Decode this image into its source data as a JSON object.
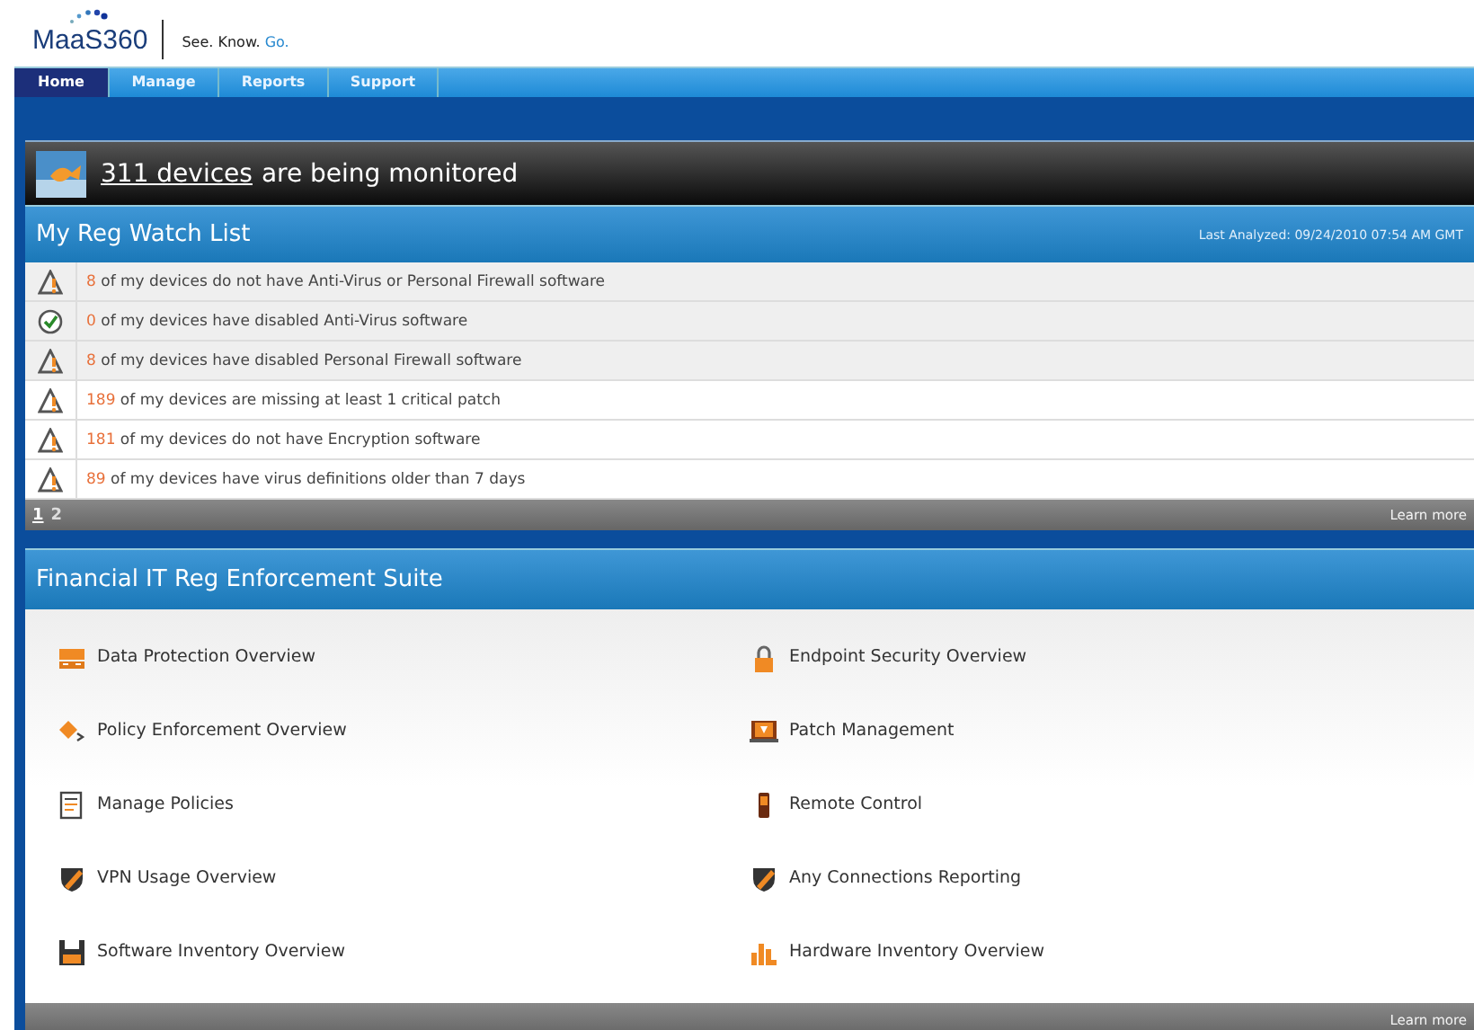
{
  "header": {
    "logo": "MaaS360",
    "tagline_plain": "See. Know.",
    "tagline_accent": "Go."
  },
  "nav": [
    {
      "label": "Home",
      "selected": true
    },
    {
      "label": "Manage",
      "selected": false
    },
    {
      "label": "Reports",
      "selected": false
    },
    {
      "label": "Support",
      "selected": false
    }
  ],
  "banner": {
    "link": "311 devices",
    "text": "are being monitored"
  },
  "watch_list": {
    "title": "My Reg Watch List",
    "last_analyzed": "Last Analyzed: 09/24/2010 07:54 AM GMT",
    "rows": [
      {
        "kind": "warning",
        "count": "8",
        "text": "of my devices do not have Anti-Virus or Personal Firewall software"
      },
      {
        "kind": "ok",
        "count": "0",
        "text": "of my devices have disabled Anti-Virus software"
      },
      {
        "kind": "warning",
        "count": "8",
        "text": "of my devices have disabled Personal Firewall software"
      },
      {
        "kind": "warning",
        "count": "189",
        "text": "of my devices are missing at least 1 critical patch"
      },
      {
        "kind": "warning",
        "count": "181",
        "text": "of my devices do not have Encryption software"
      },
      {
        "kind": "warning",
        "count": "89",
        "text": "of my devices have virus definitions older than 7 days"
      }
    ],
    "pages": [
      {
        "label": "1",
        "selected": true
      },
      {
        "label": "2",
        "selected": false
      }
    ],
    "learn_more": "Learn more"
  },
  "suite": {
    "title": "Financial IT Reg Enforcement Suite",
    "items": [
      {
        "kind": "folder",
        "label": "Data Protection Overview"
      },
      {
        "kind": "lock",
        "label": "Endpoint Security Overview"
      },
      {
        "kind": "diamond",
        "label": "Policy Enforcement Overview"
      },
      {
        "kind": "monitor",
        "label": "Patch Management"
      },
      {
        "kind": "document",
        "label": "Manage Policies"
      },
      {
        "kind": "phone",
        "label": "Remote Control"
      },
      {
        "kind": "shield",
        "label": "VPN Usage Overview"
      },
      {
        "kind": "shield",
        "label": "Any Connections Reporting"
      },
      {
        "kind": "disk",
        "label": "Software Inventory Overview"
      },
      {
        "kind": "bars",
        "label": "Hardware Inventory Overview"
      }
    ],
    "learn_more": "Learn more"
  }
}
